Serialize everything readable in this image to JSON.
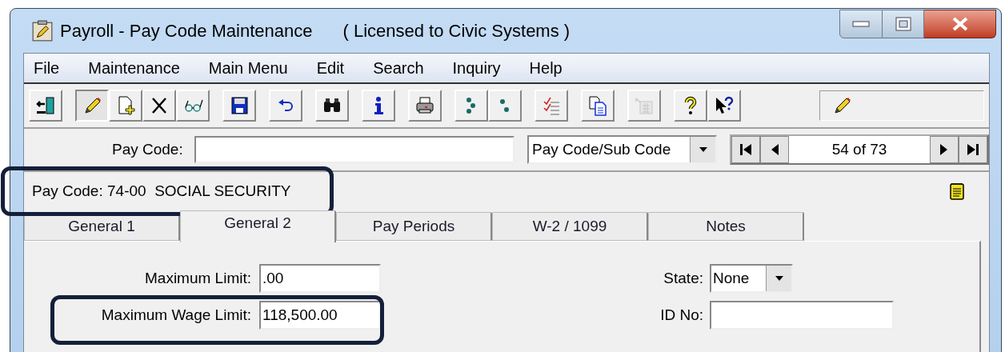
{
  "window": {
    "title": "Payroll - Pay Code Maintenance",
    "license": "( Licensed to Civic Systems )"
  },
  "menu": [
    "File",
    "Maintenance",
    "Main Menu",
    "Edit",
    "Search",
    "Inquiry",
    "Help"
  ],
  "toolbar": [
    {
      "kind": "exit",
      "selected": false,
      "disabled": false
    },
    {
      "kind": "edit",
      "selected": true,
      "disabled": false
    },
    {
      "kind": "add",
      "selected": false,
      "disabled": false
    },
    {
      "kind": "delete",
      "selected": false,
      "disabled": false
    },
    {
      "kind": "view",
      "selected": false,
      "disabled": false
    },
    {
      "kind": "save",
      "selected": false,
      "disabled": false
    },
    {
      "kind": "undo",
      "selected": false,
      "disabled": false
    },
    {
      "kind": "find",
      "selected": false,
      "disabled": false
    },
    {
      "kind": "info",
      "selected": false,
      "disabled": false
    },
    {
      "kind": "print",
      "selected": false,
      "disabled": false
    },
    {
      "kind": "dots3",
      "selected": false,
      "disabled": false
    },
    {
      "kind": "dots2",
      "selected": false,
      "disabled": false
    },
    {
      "kind": "checklist",
      "selected": false,
      "disabled": false
    },
    {
      "kind": "copy",
      "selected": false,
      "disabled": false
    },
    {
      "kind": "calendar",
      "selected": false,
      "disabled": true
    },
    {
      "kind": "help",
      "selected": false,
      "disabled": false
    },
    {
      "kind": "whatsthis",
      "selected": false,
      "disabled": false
    }
  ],
  "lookup": {
    "label": "Pay Code:"
  },
  "sort": {
    "value": "Pay Code/Sub Code"
  },
  "navigator": {
    "position": "54 of 73"
  },
  "record_header": "Pay Code: 74-00  SOCIAL SECURITY",
  "tabs": [
    {
      "label": "General 1",
      "selected": false
    },
    {
      "label": "General 2",
      "selected": true
    },
    {
      "label": "Pay Periods",
      "selected": false
    },
    {
      "label": "W-2 / 1099",
      "selected": false
    },
    {
      "label": "Notes",
      "selected": false
    }
  ],
  "left_fields": [
    {
      "label": "Maximum Limit:",
      "value": ".00",
      "kind": "text",
      "highlighted": false
    },
    {
      "label": "Maximum Wage Limit:",
      "value": "118,500.00",
      "kind": "text",
      "highlighted": true
    }
  ],
  "right_fields": [
    {
      "label": "State:",
      "value": "None",
      "kind": "dropdown"
    },
    {
      "label": "ID No:",
      "kind": "text"
    }
  ],
  "header_highlighted": true
}
